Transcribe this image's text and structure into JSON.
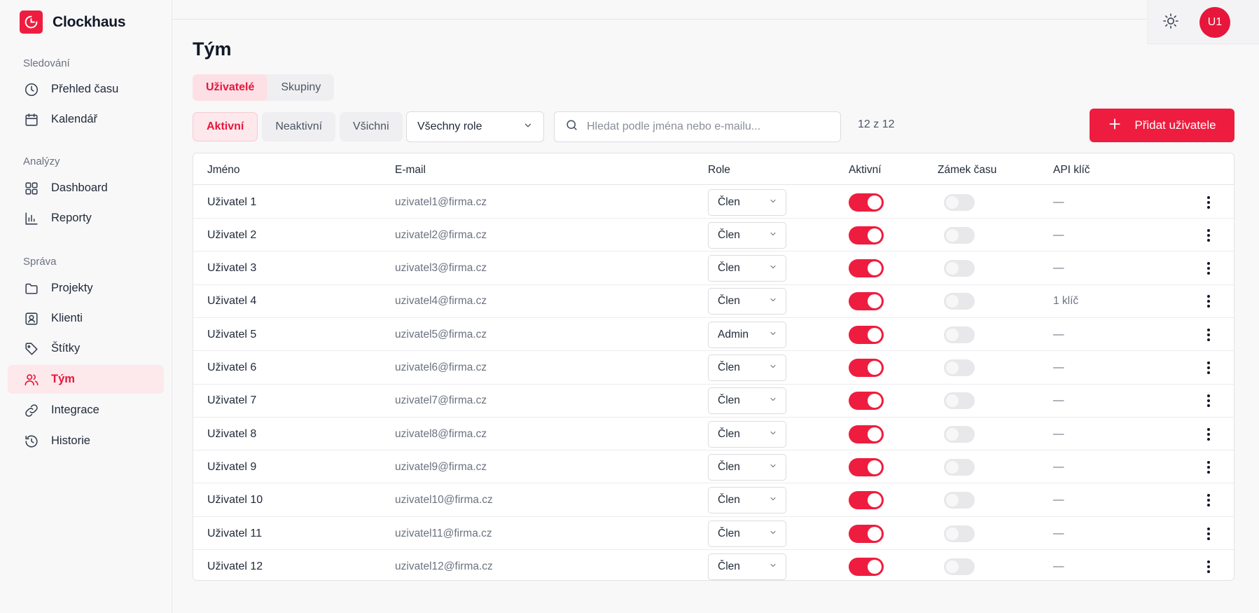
{
  "app": {
    "name": "Clockhaus"
  },
  "colors": {
    "accent": "#ee1d3f",
    "active_bg": "#fde8ec"
  },
  "sidebar": {
    "sections": [
      {
        "title": "Sledování"
      },
      {
        "title": "Analýzy"
      },
      {
        "title": "Správa"
      }
    ],
    "items": [
      {
        "label": "Přehled času",
        "icon": "clock-icon"
      },
      {
        "label": "Kalendář",
        "icon": "calendar-icon"
      },
      {
        "label": "Dashboard",
        "icon": "grid-icon"
      },
      {
        "label": "Reporty",
        "icon": "bar-chart-icon"
      },
      {
        "label": "Projekty",
        "icon": "folder-icon"
      },
      {
        "label": "Klienti",
        "icon": "user-card-icon"
      },
      {
        "label": "Štítky",
        "icon": "tag-icon"
      },
      {
        "label": "Tým",
        "icon": "users-icon",
        "active": true
      },
      {
        "label": "Integrace",
        "icon": "link-icon"
      },
      {
        "label": "Historie",
        "icon": "history-icon"
      }
    ]
  },
  "header": {
    "avatar_initials": "U1",
    "theme_icon": "sun-icon"
  },
  "main": {
    "title": "Tým",
    "tabs": [
      {
        "label": "Uživatelé",
        "active": true
      },
      {
        "label": "Skupiny",
        "active": false
      }
    ],
    "filters": [
      {
        "label": "Aktivní",
        "active": true
      },
      {
        "label": "Neaktivní",
        "active": false
      },
      {
        "label": "Všichni",
        "active": false
      }
    ],
    "role_filter": {
      "value": "Všechny role"
    },
    "search": {
      "placeholder": "Hledat podle jména nebo e-mailu..."
    },
    "count": "12 z 12",
    "add_button": "Přidat uživatele"
  },
  "table": {
    "columns": [
      "Jméno",
      "E-mail",
      "Role",
      "Aktivní",
      "Zámek času",
      "API klíč"
    ],
    "rows": [
      {
        "name": "Uživatel 1",
        "email": "uzivatel1@firma.cz",
        "role": "Člen",
        "active": true,
        "lock": false,
        "api": "—"
      },
      {
        "name": "Uživatel 2",
        "email": "uzivatel2@firma.cz",
        "role": "Člen",
        "active": true,
        "lock": false,
        "api": "—"
      },
      {
        "name": "Uživatel 3",
        "email": "uzivatel3@firma.cz",
        "role": "Člen",
        "active": true,
        "lock": false,
        "api": "—"
      },
      {
        "name": "Uživatel 4",
        "email": "uzivatel4@firma.cz",
        "role": "Člen",
        "active": true,
        "lock": false,
        "api": "1 klíč"
      },
      {
        "name": "Uživatel 5",
        "email": "uzivatel5@firma.cz",
        "role": "Admin",
        "active": true,
        "lock": false,
        "api": "—"
      },
      {
        "name": "Uživatel 6",
        "email": "uzivatel6@firma.cz",
        "role": "Člen",
        "active": true,
        "lock": false,
        "api": "—"
      },
      {
        "name": "Uživatel 7",
        "email": "uzivatel7@firma.cz",
        "role": "Člen",
        "active": true,
        "lock": false,
        "api": "—"
      },
      {
        "name": "Uživatel 8",
        "email": "uzivatel8@firma.cz",
        "role": "Člen",
        "active": true,
        "lock": false,
        "api": "—"
      },
      {
        "name": "Uživatel 9",
        "email": "uzivatel9@firma.cz",
        "role": "Člen",
        "active": true,
        "lock": false,
        "api": "—"
      },
      {
        "name": "Uživatel 10",
        "email": "uzivatel10@firma.cz",
        "role": "Člen",
        "active": true,
        "lock": false,
        "api": "—"
      },
      {
        "name": "Uživatel 11",
        "email": "uzivatel11@firma.cz",
        "role": "Člen",
        "active": true,
        "lock": false,
        "api": "—"
      },
      {
        "name": "Uživatel 12",
        "email": "uzivatel12@firma.cz",
        "role": "Člen",
        "active": true,
        "lock": false,
        "api": "—"
      }
    ]
  }
}
